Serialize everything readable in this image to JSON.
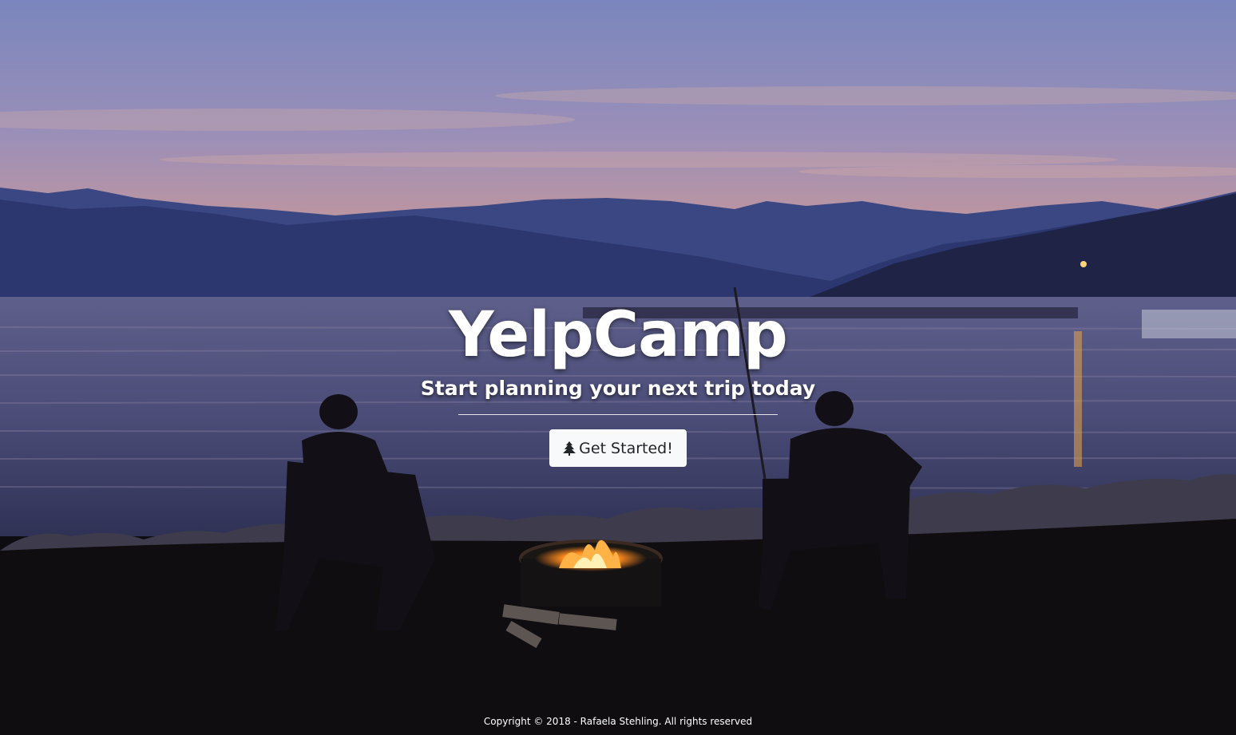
{
  "hero": {
    "title": "YelpCamp",
    "subtitle": "Start planning your next trip today",
    "cta_label": "Get Started!",
    "cta_icon": "tree-icon"
  },
  "footer": {
    "copyright": "Copyright © 2018 - Rafaela Stehling. All rights reserved"
  },
  "background": {
    "scene": "lakeside-campfire-at-dusk-photo",
    "colors": {
      "sky_top": "#7c88bf",
      "sky_horizon": "#d79a86",
      "mountains": "#2c376c",
      "lake": "#4a4f7a",
      "ground": "#0f0d10",
      "fire": "#ff9a2e"
    }
  }
}
